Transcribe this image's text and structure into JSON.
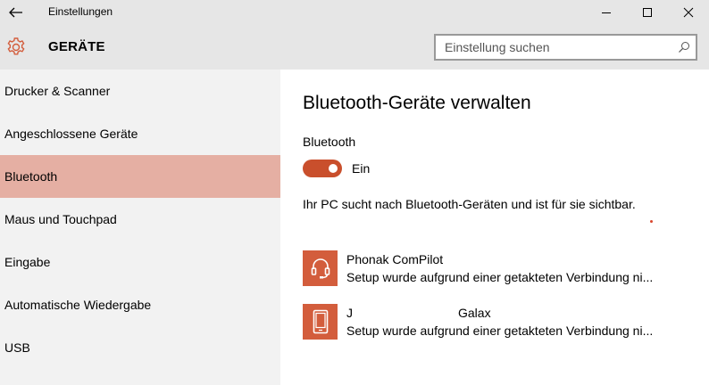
{
  "window": {
    "title": "Einstellungen"
  },
  "header": {
    "title": "GERÄTE",
    "search_placeholder": "Einstellung suchen"
  },
  "sidebar": {
    "items": [
      {
        "label": "Drucker & Scanner",
        "active": false
      },
      {
        "label": "Angeschlossene Geräte",
        "active": false
      },
      {
        "label": "Bluetooth",
        "active": true
      },
      {
        "label": "Maus und Touchpad",
        "active": false
      },
      {
        "label": "Eingabe",
        "active": false
      },
      {
        "label": "Automatische Wiedergabe",
        "active": false
      },
      {
        "label": "USB",
        "active": false
      }
    ]
  },
  "main": {
    "title": "Bluetooth-Geräte verwalten",
    "bluetooth_label": "Bluetooth",
    "toggle_state": "Ein",
    "toggle_on": true,
    "status_text": "Ihr PC sucht nach Bluetooth-Geräten und ist für sie sichtbar.",
    "devices": [
      {
        "icon": "headset-icon",
        "name": "Phonak ComPilot",
        "status": "Setup wurde aufgrund einer getakteten Verbindung ni..."
      },
      {
        "icon": "phone-icon",
        "name_prefix": "J",
        "name_suffix": "Galax",
        "status": "Setup wurde aufgrund einer getakteten Verbindung ni..."
      }
    ]
  },
  "colors": {
    "accent": "#c94f2c",
    "tile": "#d35d3c",
    "active_item": "#e5afa3",
    "sidebar_bg": "#f2f2f2",
    "header_bg": "#e6e6e6"
  }
}
